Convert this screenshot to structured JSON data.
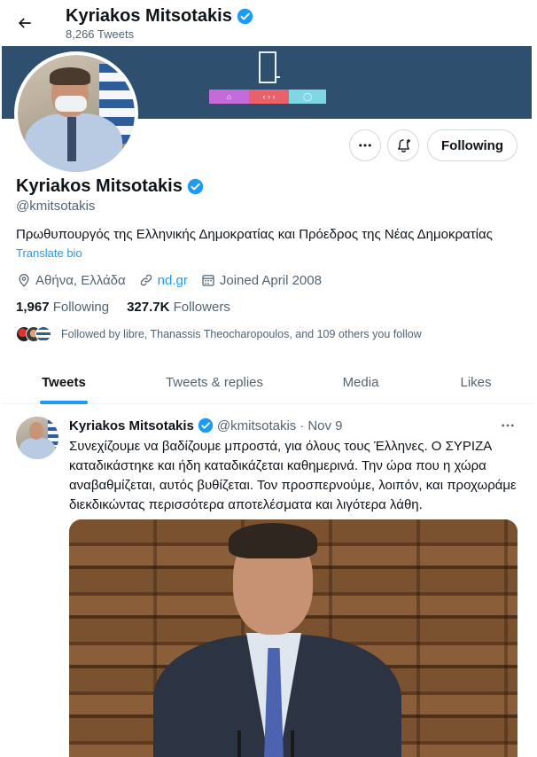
{
  "header": {
    "name": "Kyriakos Mitsotakis",
    "tweet_count": "8,266 Tweets"
  },
  "banner": {
    "strip_a": "⌂",
    "strip_b": "‹ › ‹",
    "strip_c": "◯"
  },
  "actions": {
    "following_label": "Following"
  },
  "profile": {
    "name": "Kyriakos Mitsotakis",
    "handle": "@kmitsotakis",
    "bio": "Πρωθυπουργός της Ελληνικής Δημοκρατίας και Πρόεδρος της Νέας Δημοκρατίας",
    "translate_label": "Translate bio",
    "location": "Αθήνα, Ελλάδα",
    "website": "nd.gr",
    "joined": "Joined April 2008",
    "following_count": "1,967",
    "following_label": "Following",
    "followers_count": "327.7K",
    "followers_label": "Followers",
    "followed_by": "Followed by libre, Thanassis Theocharopoulos, and 109 others you follow"
  },
  "tabs": [
    "Tweets",
    "Tweets & replies",
    "Media",
    "Likes"
  ],
  "tweet": {
    "name": "Kyriakos Mitsotakis",
    "handle": "@kmitsotakis",
    "dot": "·",
    "date": "Nov 9",
    "text": "Συνεχίζουμε να βαδίζουμε μπροστά, για όλους τους Έλληνες. Ο ΣΥΡΙΖΑ καταδικάστηκε και ήδη καταδικάζεται καθημερινά. Την ώρα που η χώρα αναβαθμίζεται, αυτός βυθίζεται. Τον προσπερνούμε, λοιπόν, και προχωράμε διεκδικώντας περισσότερα αποτελέσματα και λιγότερα λάθη."
  },
  "colors": {
    "accent": "#1d9bf0",
    "text_primary": "#0f1419",
    "text_secondary": "#536471",
    "banner": "#2e4f6e"
  },
  "icons": [
    "back-arrow-icon",
    "verified-badge-icon",
    "more-icon",
    "notification-bell-icon",
    "location-icon",
    "link-icon",
    "calendar-icon"
  ]
}
